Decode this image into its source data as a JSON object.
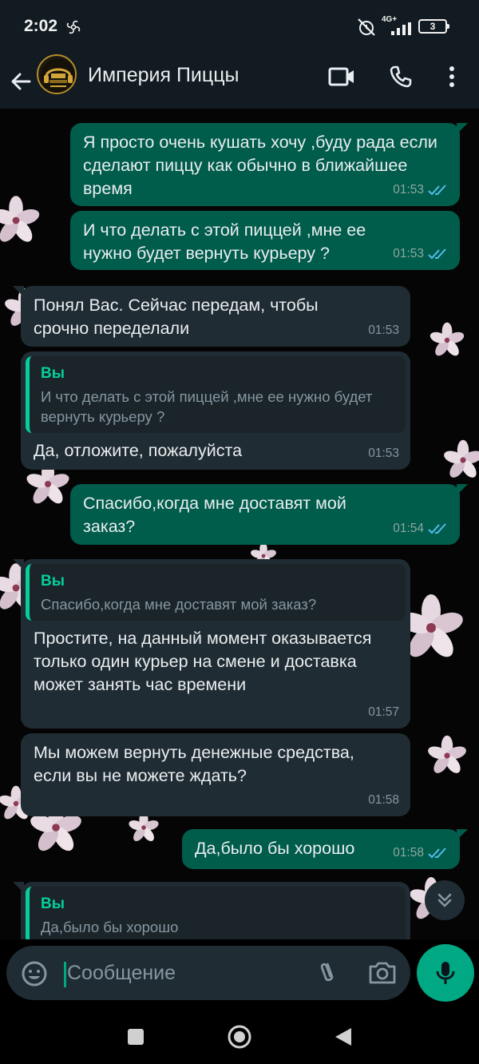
{
  "status_bar": {
    "time": "2:02",
    "network": "4G+",
    "battery": "3"
  },
  "header": {
    "title": "Империя Пиццы"
  },
  "messages": [
    {
      "direction": "out",
      "text": "Я просто очень кушать хочу ,буду рада если сделают пиццу как обычно в ближайшее время",
      "time": "01:53",
      "status": "read"
    },
    {
      "direction": "out",
      "text": "И что делать с этой пиццей ,мне ее нужно будет вернуть курьеру ?",
      "time": "01:53",
      "status": "read"
    },
    {
      "direction": "in",
      "text": "Понял Вас. Сейчас передам, чтобы срочно переделали",
      "time": "01:53"
    },
    {
      "direction": "in",
      "quote_author": "Вы",
      "quote_text": "И что делать с этой пиццей ,мне ее нужно будет вернуть курьеру ?",
      "text": "Да, отложите, пожалуйста",
      "time": "01:53"
    },
    {
      "direction": "out",
      "text": "Спасибо,когда мне доставят мой заказ?",
      "time": "01:54",
      "status": "read"
    },
    {
      "direction": "in",
      "quote_author": "Вы",
      "quote_text": "Спасибо,когда мне доставят мой заказ?",
      "text": "Простите, на данный момент оказывается только один курьер на смене и доставка может занять час времени",
      "time": "01:57"
    },
    {
      "direction": "in",
      "text": "Мы можем вернуть денежные средства, если вы не можете ждать?",
      "time": "01:58"
    },
    {
      "direction": "out",
      "text": "Да,было бы хорошо",
      "time": "01:58",
      "status": "read"
    },
    {
      "direction": "in",
      "quote_author": "Вы",
      "quote_text": "Да,было бы хорошо",
      "text": "",
      "time": ""
    }
  ],
  "composer": {
    "placeholder": "Сообщение"
  },
  "colors": {
    "outgoing": "#005c4b",
    "incoming": "#202c33",
    "accent": "#00a884",
    "read_ticks": "#53bdeb"
  },
  "icons": {
    "header": [
      "back-arrow-icon",
      "video-call-icon",
      "phone-icon",
      "more-vert-icon"
    ],
    "composer": [
      "emoji-icon",
      "attach-icon",
      "camera-icon",
      "mic-icon"
    ],
    "nav": [
      "recents-icon",
      "home-icon",
      "back-icon"
    ]
  }
}
